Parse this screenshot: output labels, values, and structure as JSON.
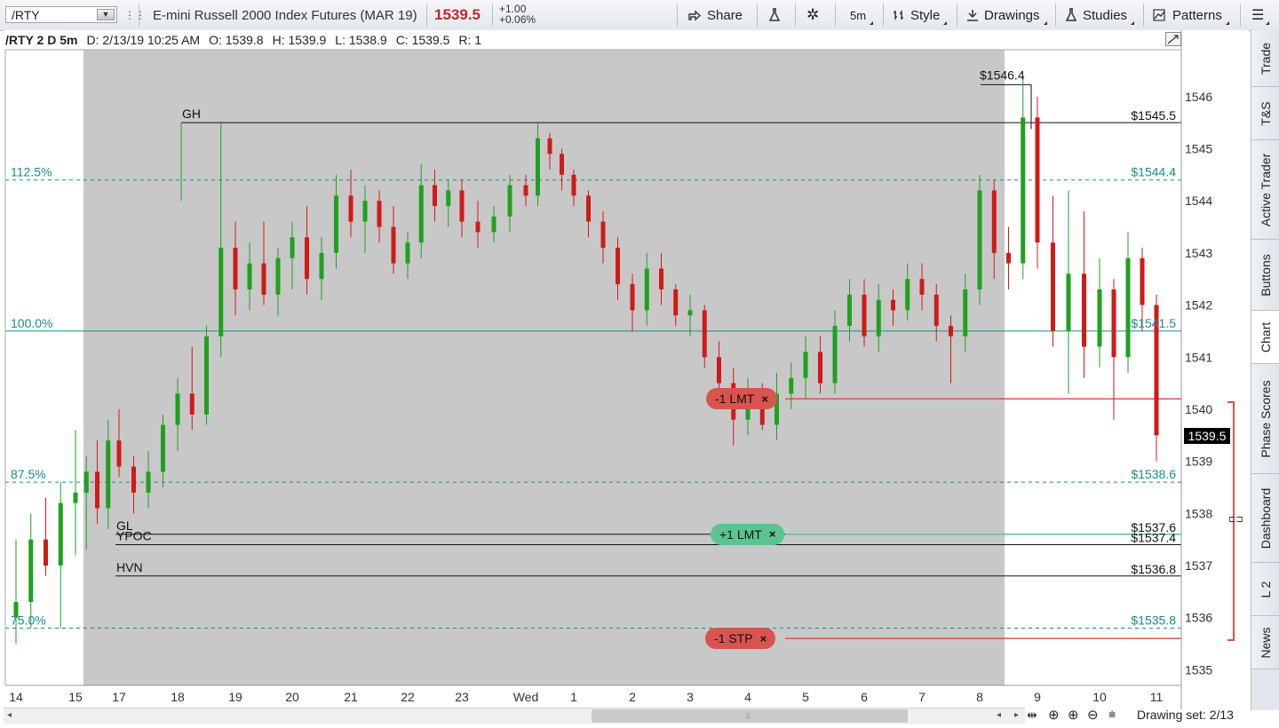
{
  "toolbar": {
    "symbol": "/RTY",
    "description": "E-mini Russell 2000 Index Futures (MAR 19)",
    "last_price": "1539.5",
    "change": "+1.00",
    "change_pct": "+0.06%",
    "share_label": "Share",
    "timeframe": "5m",
    "style_label": "Style",
    "drawings_label": "Drawings",
    "studies_label": "Studies",
    "patterns_label": "Patterns"
  },
  "header": {
    "chart_label": "/RTY 2 D 5m",
    "date": "D: 2/13/19 10:25 AM",
    "open": "O: 1539.8",
    "high": "H: 1539.9",
    "low": "L: 1538.9",
    "close": "C: 1539.5",
    "range": "R: 1"
  },
  "colors": {
    "up": "#1fa11f",
    "down": "#d01a1a",
    "fib": "#1b8b8b",
    "session_shade": "#c8c8c8",
    "order_red": "#d9534f",
    "order_green": "#5cc391"
  },
  "chart_data": {
    "type": "candlestick",
    "x_ticks": [
      "14",
      "15",
      "17",
      "18",
      "19",
      "20",
      "21",
      "22",
      "23",
      "Wed",
      "1",
      "2",
      "3",
      "4",
      "5",
      "6",
      "7",
      "8",
      "9",
      "10",
      "11"
    ],
    "y_ticks": [
      "1546",
      "1545",
      "1544",
      "1543",
      "1542",
      "1541",
      "1540",
      "1539",
      "1538",
      "1537",
      "1536",
      "1535"
    ],
    "ylim": [
      1534.7,
      1546.9
    ],
    "fib_levels": [
      {
        "label": "112.5%",
        "value": 1544.4,
        "price_label": "$1544.4",
        "style": "dashed"
      },
      {
        "label": "100.0%",
        "value": 1541.5,
        "price_label": "$1541.5",
        "style": "solid"
      },
      {
        "label": "87.5%",
        "value": 1538.6,
        "price_label": "$1538.6",
        "style": "dashed"
      },
      {
        "label": "75.0%",
        "value": 1535.8,
        "price_label": "$1535.8",
        "style": "dashed"
      }
    ],
    "levels": [
      {
        "label": "GH",
        "value": 1545.5,
        "price_label": "$1545.5"
      },
      {
        "label": "GL",
        "value": 1537.6,
        "price_label": "$1537.6"
      },
      {
        "label": "YPOC",
        "value": 1537.4,
        "price_label": "$1537.4"
      },
      {
        "label": "HVN",
        "value": 1536.8,
        "price_label": "$1536.8"
      }
    ],
    "high_marker": {
      "value": 1546.4,
      "label": "$1546.4"
    },
    "current_price": "1539.5",
    "series": [
      {
        "x": 0,
        "o": 1536,
        "h": 1537.5,
        "l": 1535.5,
        "c": 1536.3
      },
      {
        "x": 0.25,
        "o": 1536.3,
        "h": 1538,
        "l": 1535.8,
        "c": 1537.5
      },
      {
        "x": 0.5,
        "o": 1537.5,
        "h": 1538.3,
        "l": 1536.8,
        "c": 1537
      },
      {
        "x": 0.75,
        "o": 1537,
        "h": 1538.6,
        "l": 1535.8,
        "c": 1538.2
      },
      {
        "x": 1,
        "o": 1538.2,
        "h": 1539.6,
        "l": 1537.2,
        "c": 1538.4
      },
      {
        "x": 1.25,
        "o": 1538.4,
        "h": 1539.1,
        "l": 1537.3,
        "c": 1538.8
      },
      {
        "x": 1.5,
        "o": 1538.8,
        "h": 1539.4,
        "l": 1537.8,
        "c": 1538.1
      },
      {
        "x": 1.75,
        "o": 1538.1,
        "h": 1539.8,
        "l": 1537.7,
        "c": 1539.4
      },
      {
        "x": 2,
        "o": 1539.4,
        "h": 1540,
        "l": 1538.7,
        "c": 1538.9
      },
      {
        "x": 2.25,
        "o": 1538.9,
        "h": 1539.1,
        "l": 1538,
        "c": 1538.4
      },
      {
        "x": 2.5,
        "o": 1538.4,
        "h": 1539.2,
        "l": 1538.1,
        "c": 1538.8
      },
      {
        "x": 2.75,
        "o": 1538.8,
        "h": 1539.9,
        "l": 1538.5,
        "c": 1539.7
      },
      {
        "x": 3,
        "o": 1539.7,
        "h": 1540.6,
        "l": 1539.2,
        "c": 1540.3
      },
      {
        "x": 3.25,
        "o": 1540.3,
        "h": 1541.2,
        "l": 1539.6,
        "c": 1539.9
      },
      {
        "x": 3.5,
        "o": 1539.9,
        "h": 1541.6,
        "l": 1539.7,
        "c": 1541.4
      },
      {
        "x": 3.75,
        "o": 1541.4,
        "h": 1545.5,
        "l": 1541,
        "c": 1543.1
      },
      {
        "x": 4,
        "o": 1543.1,
        "h": 1543.6,
        "l": 1541.8,
        "c": 1542.3
      },
      {
        "x": 4.25,
        "o": 1542.3,
        "h": 1543.2,
        "l": 1541.9,
        "c": 1542.8
      },
      {
        "x": 4.5,
        "o": 1542.8,
        "h": 1543.6,
        "l": 1542,
        "c": 1542.2
      },
      {
        "x": 4.75,
        "o": 1542.2,
        "h": 1543.1,
        "l": 1541.8,
        "c": 1542.9
      },
      {
        "x": 5,
        "o": 1542.9,
        "h": 1543.6,
        "l": 1542.3,
        "c": 1543.3
      },
      {
        "x": 5.25,
        "o": 1543.3,
        "h": 1543.9,
        "l": 1542.2,
        "c": 1542.5
      },
      {
        "x": 5.5,
        "o": 1542.5,
        "h": 1543.3,
        "l": 1542.1,
        "c": 1543
      },
      {
        "x": 5.75,
        "o": 1543,
        "h": 1544.5,
        "l": 1542.7,
        "c": 1544.1
      },
      {
        "x": 6,
        "o": 1544.1,
        "h": 1544.6,
        "l": 1543.3,
        "c": 1543.6
      },
      {
        "x": 6.25,
        "o": 1543.6,
        "h": 1544.3,
        "l": 1543,
        "c": 1544
      },
      {
        "x": 6.5,
        "o": 1544,
        "h": 1544.2,
        "l": 1543.2,
        "c": 1543.5
      },
      {
        "x": 6.75,
        "o": 1543.5,
        "h": 1543.9,
        "l": 1542.6,
        "c": 1542.8
      },
      {
        "x": 7,
        "o": 1542.8,
        "h": 1543.4,
        "l": 1542.5,
        "c": 1543.2
      },
      {
        "x": 7.25,
        "o": 1543.2,
        "h": 1544.7,
        "l": 1542.9,
        "c": 1544.3
      },
      {
        "x": 7.5,
        "o": 1544.3,
        "h": 1544.6,
        "l": 1543.6,
        "c": 1543.9
      },
      {
        "x": 7.75,
        "o": 1543.9,
        "h": 1544.4,
        "l": 1543.5,
        "c": 1544.2
      },
      {
        "x": 8,
        "o": 1544.2,
        "h": 1544.4,
        "l": 1543.3,
        "c": 1543.6
      },
      {
        "x": 8.25,
        "o": 1543.6,
        "h": 1544,
        "l": 1543.1,
        "c": 1543.4
      },
      {
        "x": 8.5,
        "o": 1543.4,
        "h": 1543.9,
        "l": 1543.2,
        "c": 1543.7
      },
      {
        "x": 8.75,
        "o": 1543.7,
        "h": 1544.5,
        "l": 1543.4,
        "c": 1544.3
      },
      {
        "x": 9,
        "o": 1544.3,
        "h": 1544.5,
        "l": 1543.9,
        "c": 1544.1
      },
      {
        "x": 9.25,
        "o": 1544.1,
        "h": 1545.5,
        "l": 1543.9,
        "c": 1545.2
      },
      {
        "x": 9.5,
        "o": 1545.2,
        "h": 1545.3,
        "l": 1544.6,
        "c": 1544.9
      },
      {
        "x": 9.75,
        "o": 1544.9,
        "h": 1545,
        "l": 1544.2,
        "c": 1544.5
      },
      {
        "x": 10,
        "o": 1544.5,
        "h": 1544.6,
        "l": 1543.9,
        "c": 1544.1
      },
      {
        "x": 10.25,
        "o": 1544.1,
        "h": 1544.2,
        "l": 1543.3,
        "c": 1543.6
      },
      {
        "x": 10.5,
        "o": 1543.6,
        "h": 1543.8,
        "l": 1542.8,
        "c": 1543.1
      },
      {
        "x": 10.75,
        "o": 1543.1,
        "h": 1543.3,
        "l": 1542.1,
        "c": 1542.4
      },
      {
        "x": 11,
        "o": 1542.4,
        "h": 1542.6,
        "l": 1541.5,
        "c": 1541.9
      },
      {
        "x": 11.25,
        "o": 1541.9,
        "h": 1543,
        "l": 1541.6,
        "c": 1542.7
      },
      {
        "x": 11.5,
        "o": 1542.7,
        "h": 1543,
        "l": 1542,
        "c": 1542.3
      },
      {
        "x": 11.75,
        "o": 1542.3,
        "h": 1542.4,
        "l": 1541.6,
        "c": 1541.8
      },
      {
        "x": 12,
        "o": 1541.8,
        "h": 1542.2,
        "l": 1541.4,
        "c": 1541.9
      },
      {
        "x": 12.25,
        "o": 1541.9,
        "h": 1542,
        "l": 1540.8,
        "c": 1541
      },
      {
        "x": 12.5,
        "o": 1541,
        "h": 1541.3,
        "l": 1540.2,
        "c": 1540.5
      },
      {
        "x": 12.75,
        "o": 1540.5,
        "h": 1540.8,
        "l": 1539.3,
        "c": 1539.8
      },
      {
        "x": 13,
        "o": 1539.8,
        "h": 1540.6,
        "l": 1539.5,
        "c": 1540.4
      },
      {
        "x": 13.25,
        "o": 1540.4,
        "h": 1540.5,
        "l": 1539.6,
        "c": 1539.7
      },
      {
        "x": 13.5,
        "o": 1539.7,
        "h": 1540.7,
        "l": 1539.4,
        "c": 1540.3
      },
      {
        "x": 13.75,
        "o": 1540.3,
        "h": 1540.9,
        "l": 1540,
        "c": 1540.6
      },
      {
        "x": 14,
        "o": 1540.6,
        "h": 1541.4,
        "l": 1540.2,
        "c": 1541.1
      },
      {
        "x": 14.25,
        "o": 1541.1,
        "h": 1541.4,
        "l": 1540.3,
        "c": 1540.5
      },
      {
        "x": 14.5,
        "o": 1540.5,
        "h": 1541.9,
        "l": 1540.3,
        "c": 1541.6
      },
      {
        "x": 14.75,
        "o": 1541.6,
        "h": 1542.5,
        "l": 1541.3,
        "c": 1542.2
      },
      {
        "x": 15,
        "o": 1542.2,
        "h": 1542.5,
        "l": 1541.2,
        "c": 1541.4
      },
      {
        "x": 15.25,
        "o": 1541.4,
        "h": 1542.4,
        "l": 1541.1,
        "c": 1542.1
      },
      {
        "x": 15.5,
        "o": 1542.1,
        "h": 1542.3,
        "l": 1541.6,
        "c": 1541.9
      },
      {
        "x": 15.75,
        "o": 1541.9,
        "h": 1542.8,
        "l": 1541.7,
        "c": 1542.5
      },
      {
        "x": 16,
        "o": 1542.5,
        "h": 1542.8,
        "l": 1541.9,
        "c": 1542.2
      },
      {
        "x": 16.25,
        "o": 1542.2,
        "h": 1542.4,
        "l": 1541.3,
        "c": 1541.6
      },
      {
        "x": 16.5,
        "o": 1541.6,
        "h": 1541.8,
        "l": 1540.5,
        "c": 1541.4
      },
      {
        "x": 16.75,
        "o": 1541.4,
        "h": 1542.6,
        "l": 1541.1,
        "c": 1542.3
      },
      {
        "x": 17,
        "o": 1542.3,
        "h": 1544.5,
        "l": 1542,
        "c": 1544.2
      },
      {
        "x": 17.25,
        "o": 1544.2,
        "h": 1544.4,
        "l": 1542.5,
        "c": 1543
      },
      {
        "x": 17.5,
        "o": 1543,
        "h": 1543.5,
        "l": 1542.3,
        "c": 1542.8
      },
      {
        "x": 17.75,
        "o": 1542.8,
        "h": 1546.4,
        "l": 1542.5,
        "c": 1545.6
      },
      {
        "x": 18,
        "o": 1545.6,
        "h": 1546,
        "l": 1542.7,
        "c": 1543.2
      },
      {
        "x": 18.25,
        "o": 1543.2,
        "h": 1544.1,
        "l": 1541.2,
        "c": 1541.5
      },
      {
        "x": 18.5,
        "o": 1541.5,
        "h": 1544.2,
        "l": 1540.3,
        "c": 1542.6
      },
      {
        "x": 18.75,
        "o": 1542.6,
        "h": 1543.8,
        "l": 1540.6,
        "c": 1541.2
      },
      {
        "x": 19,
        "o": 1541.2,
        "h": 1542.9,
        "l": 1540.8,
        "c": 1542.3
      },
      {
        "x": 19.25,
        "o": 1542.3,
        "h": 1542.5,
        "l": 1539.8,
        "c": 1541
      },
      {
        "x": 19.5,
        "o": 1541,
        "h": 1543.4,
        "l": 1540.7,
        "c": 1542.9
      },
      {
        "x": 19.75,
        "o": 1542.9,
        "h": 1543.1,
        "l": 1541.5,
        "c": 1542
      },
      {
        "x": 20,
        "o": 1542,
        "h": 1542.2,
        "l": 1539,
        "c": 1539.5
      }
    ]
  },
  "orders": [
    {
      "label": "-1 LMT",
      "close": "×",
      "value": 1540.2
    },
    {
      "label": "+1 LMT",
      "close": "×",
      "value": 1537.6
    },
    {
      "label": "-1 STP",
      "close": "×",
      "value": 1535.6
    }
  ],
  "sidetabs": [
    "Trade",
    "T&S",
    "Active Trader",
    "Buttons",
    "Chart",
    "Phase Scores",
    "Dashboard",
    "L 2",
    "News"
  ],
  "bottom": {
    "drawing_set": "Drawing set: 2/13"
  }
}
